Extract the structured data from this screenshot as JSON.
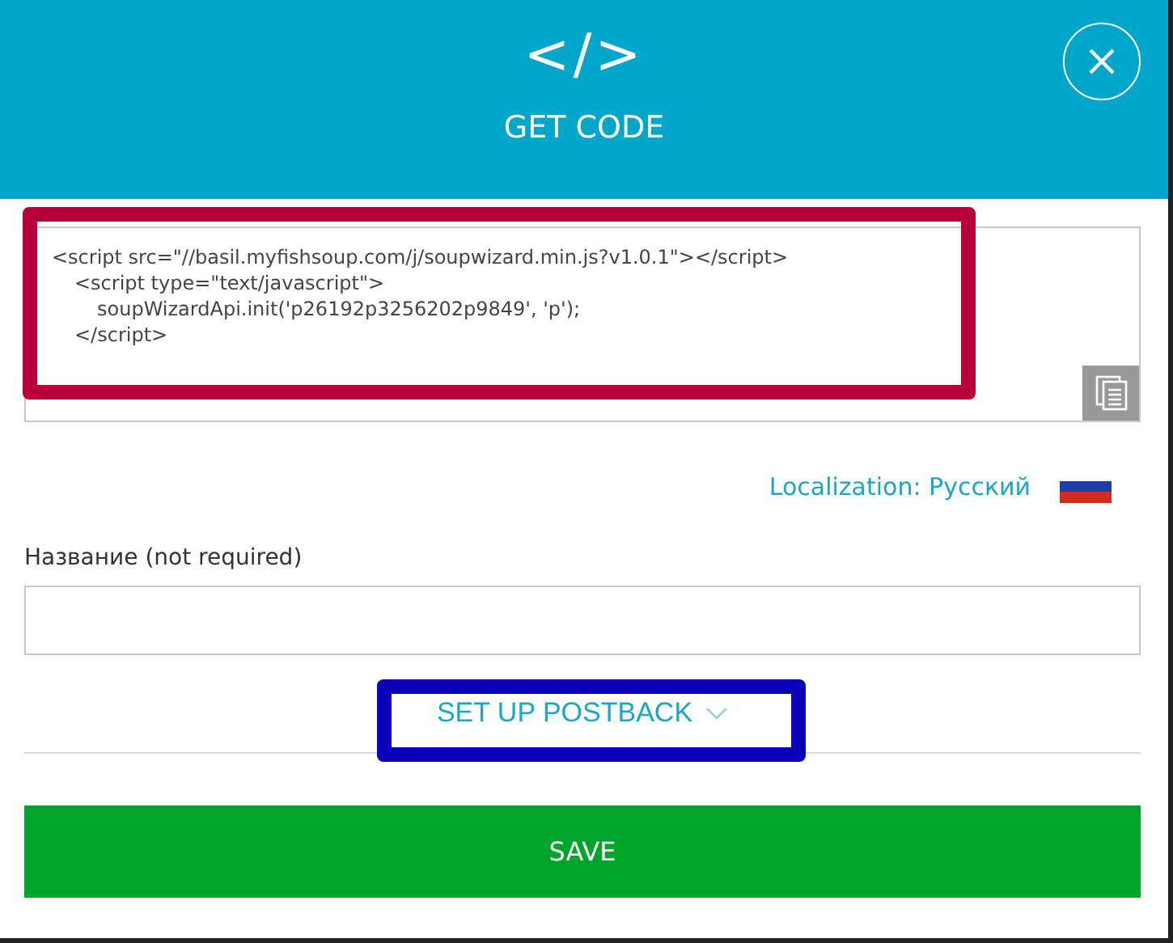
{
  "header": {
    "title": "GET CODE",
    "icon": "</>"
  },
  "code": {
    "lines": [
      {
        "text": "<script src=\"//basil.myfishsoup.com/j/soupwizard.min.js?v1.0.1\"></script>",
        "kind": "outer"
      },
      {
        "text": "<script type=\"text/javascript\">",
        "kind": "tag"
      },
      {
        "text": "soupWizardApi.init('p26192p3256202p9849', 'p');",
        "kind": "body"
      },
      {
        "text": "</script>",
        "kind": "tag"
      }
    ]
  },
  "localization": {
    "label": "Localization: Русский"
  },
  "name_field": {
    "label": "Название (not required)"
  },
  "postback": {
    "label": "SET UP POSTBACK",
    "expanded": false
  },
  "save": {
    "label": "SAVE"
  },
  "highlights": [
    {
      "color": "#b8003a"
    },
    {
      "color": "#0a00b8"
    }
  ]
}
